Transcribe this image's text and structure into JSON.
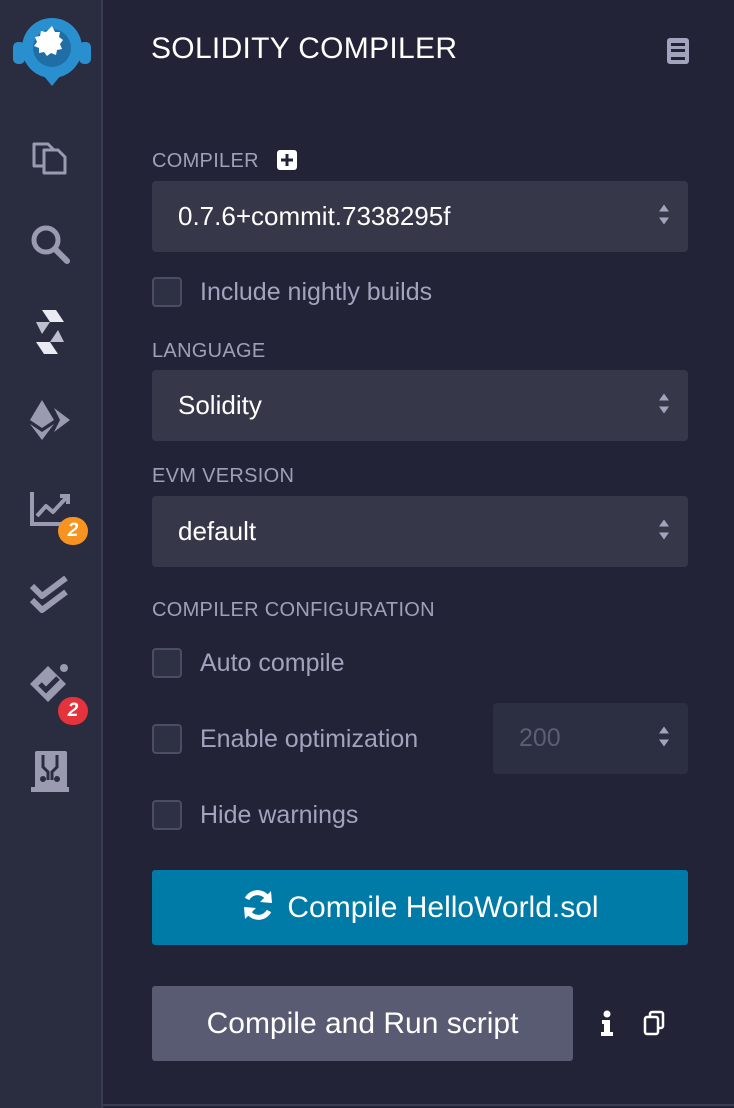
{
  "panel": {
    "title": "SOLIDITY COMPILER"
  },
  "rail": {
    "items": [
      {
        "icon": "remix-logo-icon"
      },
      {
        "icon": "file-explorer-icon"
      },
      {
        "icon": "search-icon"
      },
      {
        "icon": "solidity-compiler-icon"
      },
      {
        "icon": "deploy-run-icon"
      },
      {
        "icon": "analysis-icon",
        "badge": "2"
      },
      {
        "icon": "testing-icon"
      },
      {
        "icon": "static-check-icon",
        "badge": "2"
      },
      {
        "icon": "plugin-icon"
      }
    ]
  },
  "compiler": {
    "label": "COMPILER",
    "version": "0.7.6+commit.7338295f",
    "nightly_label": "Include nightly builds"
  },
  "language": {
    "label": "LANGUAGE",
    "value": "Solidity"
  },
  "evm": {
    "label": "EVM VERSION",
    "value": "default"
  },
  "config": {
    "label": "COMPILER CONFIGURATION",
    "auto_compile": "Auto compile",
    "enable_optimization": "Enable optimization",
    "runs_value": "200",
    "hide_warnings": "Hide warnings"
  },
  "actions": {
    "compile_label": "Compile HelloWorld.sol",
    "run_label": "Compile and Run script"
  },
  "colors": {
    "background": "#222336",
    "rail": "#2a2c3f",
    "select": "#363849",
    "primary": "#007aa6",
    "secondary": "#595b73",
    "badge_orange": "#f7931e",
    "badge_red": "#e4333b",
    "logo_blue": "#2a8fce"
  }
}
